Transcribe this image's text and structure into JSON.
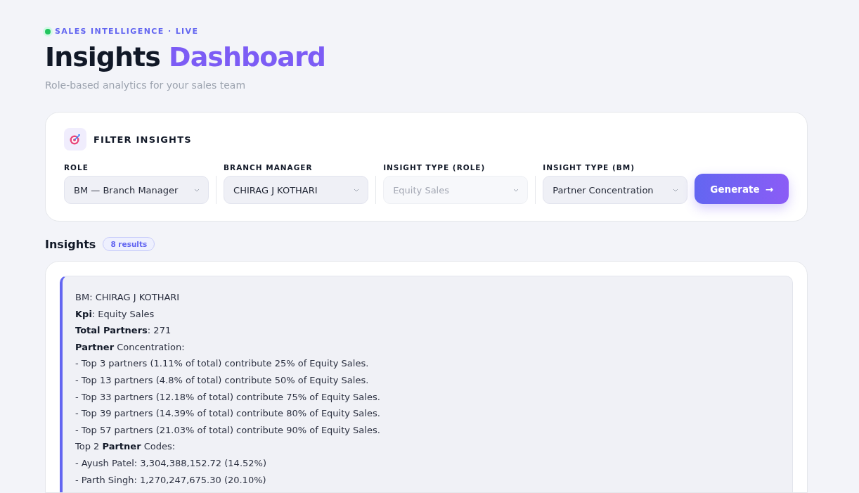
{
  "eyebrow": {
    "text": "SALES INTELLIGENCE · LIVE",
    "live": true
  },
  "title": {
    "main": "Insights",
    "accent": "Dashboard"
  },
  "subtitle": "Role-based analytics for your sales team",
  "filter_panel": {
    "title": "FILTER INSIGHTS",
    "filters": [
      {
        "label": "ROLE",
        "value": "BM — Branch Manager",
        "disabled": false
      },
      {
        "label": "BRANCH MANAGER",
        "value": "CHIRAG J KOTHARI",
        "disabled": false
      },
      {
        "label": "INSIGHT TYPE (ROLE)",
        "value": "Equity Sales",
        "disabled": true
      },
      {
        "label": "INSIGHT TYPE (BM)",
        "value": "Partner Concentration",
        "disabled": false
      }
    ],
    "button": "Generate",
    "button_arrow": "→"
  },
  "insights": {
    "title": "Insights",
    "count": "8 results",
    "lines": [
      "BM: CHIRAG J KOTHARI",
      "**Kpi**: Equity Sales",
      "**Total Partners**: 271",
      "**Partner** Concentration:",
      "- Top 3 partners (1.11% of total) contribute 25% of Equity Sales.",
      "- Top 13 partners (4.8% of total) contribute 50% of Equity Sales.",
      "- Top 33 partners (12.18% of total) contribute 75% of Equity Sales.",
      "- Top 39 partners (14.39% of total) contribute 80% of Equity Sales.",
      "- Top 57 partners (21.03% of total) contribute 90% of Equity Sales.",
      "Top 2 **Partner** Codes:",
      "- Ayush Patel: 3,304,388,152.72 (14.52%)",
      "- Parth Singh: 1,270,247,675.30 (20.10%)"
    ]
  }
}
